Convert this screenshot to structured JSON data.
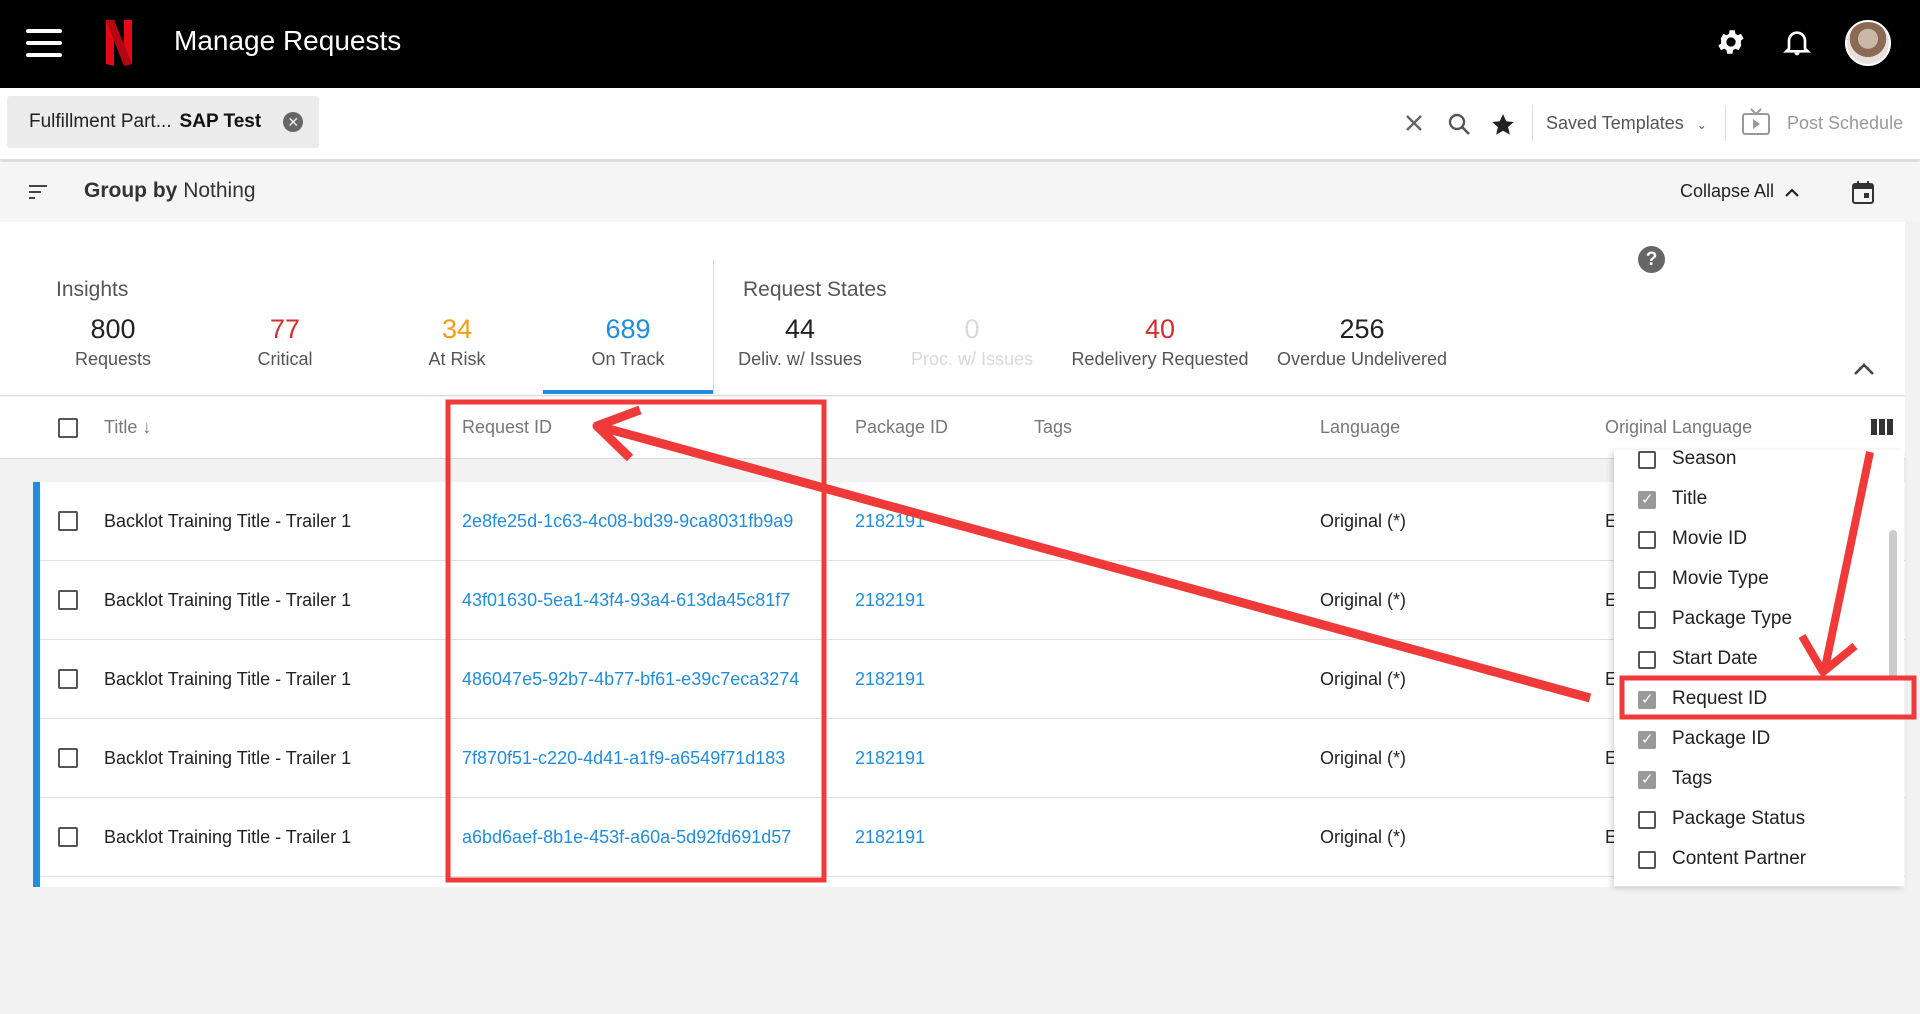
{
  "app": {
    "title": "Manage Requests",
    "logo_letter": "N"
  },
  "filter": {
    "chip_key": "Fulfillment Part...",
    "chip_value": "SAP Test",
    "saved_templates": "Saved Templates",
    "post_schedule": "Post Schedule"
  },
  "group": {
    "label": "Group by",
    "value": "Nothing",
    "collapse_all": "Collapse All"
  },
  "insights": {
    "title": "Insights",
    "metrics": [
      {
        "value": "800",
        "label": "Requests",
        "color": "#222222"
      },
      {
        "value": "77",
        "label": "Critical",
        "color": "#d32f2f"
      },
      {
        "value": "34",
        "label": "At Risk",
        "color": "#f39c12"
      },
      {
        "value": "689",
        "label": "On Track",
        "color": "#1f8de0"
      }
    ]
  },
  "request_states": {
    "title": "Request States",
    "metrics": [
      {
        "value": "44",
        "label": "Deliv. w/ Issues",
        "color": "#222222"
      },
      {
        "value": "0",
        "label": "Proc. w/ Issues",
        "color": "#d9d9d9"
      },
      {
        "value": "40",
        "label": "Redelivery Requested",
        "color": "#d32f2f"
      },
      {
        "value": "256",
        "label": "Overdue Undelivered",
        "color": "#222222"
      }
    ]
  },
  "table": {
    "headers": {
      "title": "Title ↓",
      "request_id": "Request ID",
      "package_id": "Package ID",
      "tags": "Tags",
      "language": "Language",
      "original_language": "Original Language"
    },
    "rows": [
      {
        "title": "Backlot Training Title - Trailer 1",
        "request_id": "2e8fe25d-1c63-4c08-bd39-9ca8031fb9a9",
        "package_id": "2182191",
        "language": "Original (*)",
        "orig": "E"
      },
      {
        "title": "Backlot Training Title - Trailer 1",
        "request_id": "43f01630-5ea1-43f4-93a4-613da45c81f7",
        "package_id": "2182191",
        "language": "Original (*)",
        "orig": "E"
      },
      {
        "title": "Backlot Training Title - Trailer 1",
        "request_id": "486047e5-92b7-4b77-bf61-e39c7eca3274",
        "package_id": "2182191",
        "language": "Original (*)",
        "orig": "E"
      },
      {
        "title": "Backlot Training Title - Trailer 1",
        "request_id": "7f870f51-c220-4d41-a1f9-a6549f71d183",
        "package_id": "2182191",
        "language": "Original (*)",
        "orig": "E"
      },
      {
        "title": "Backlot Training Title - Trailer 1",
        "request_id": "a6bd6aef-8b1e-453f-a60a-5d92fd691d57",
        "package_id": "2182191",
        "language": "Original (*)",
        "orig": "E"
      }
    ]
  },
  "columns_menu": {
    "items": [
      {
        "label": "Season",
        "checked": false
      },
      {
        "label": "Title",
        "checked": true
      },
      {
        "label": "Movie ID",
        "checked": false
      },
      {
        "label": "Movie Type",
        "checked": false
      },
      {
        "label": "Package Type",
        "checked": false
      },
      {
        "label": "Start Date",
        "checked": false
      },
      {
        "label": "Request ID",
        "checked": true
      },
      {
        "label": "Package ID",
        "checked": true
      },
      {
        "label": "Tags",
        "checked": true
      },
      {
        "label": "Package Status",
        "checked": false
      },
      {
        "label": "Content Partner",
        "checked": false
      }
    ]
  },
  "annotation_color": "#f03a3a"
}
